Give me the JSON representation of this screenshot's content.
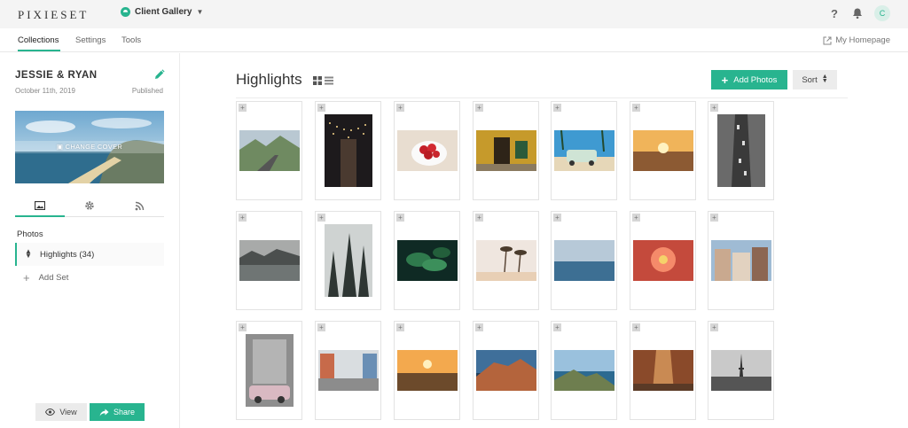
{
  "app": {
    "logo": "PIXIESET",
    "gallery_switch": "Client Gallery"
  },
  "header": {
    "help_icon": "?",
    "avatar_initial": "C"
  },
  "subnav": {
    "tabs": [
      "Collections",
      "Settings",
      "Tools"
    ],
    "active_tab": "Collections",
    "homepage_link": "My Homepage"
  },
  "sidebar": {
    "collection_title": "JESSIE & RYAN",
    "date": "October 11th, 2019",
    "status": "Published",
    "cover_label": "CHANGE COVER",
    "tabs": [
      "image-icon",
      "gear-icon",
      "rss-icon"
    ],
    "photos_heading": "Photos",
    "sets": [
      {
        "label": "Highlights (34)"
      }
    ],
    "add_set_label": "Add Set",
    "view_label": "View",
    "share_label": "Share"
  },
  "main": {
    "title": "Highlights",
    "add_photos_label": "Add Photos",
    "sort_label": "Sort",
    "handle_glyph": "+"
  },
  "photos": [
    {
      "subject": "mountain road",
      "orientation": "landscape"
    },
    {
      "subject": "string lights alley",
      "orientation": "portrait"
    },
    {
      "subject": "strawberries in cup",
      "orientation": "landscape"
    },
    {
      "subject": "yellow doorway",
      "orientation": "landscape"
    },
    {
      "subject": "van under palm trees",
      "orientation": "landscape"
    },
    {
      "subject": "sunset over city",
      "orientation": "landscape"
    },
    {
      "subject": "aerial street",
      "orientation": "portrait"
    },
    {
      "subject": "misty lake",
      "orientation": "landscape"
    },
    {
      "subject": "pine forest fog",
      "orientation": "portrait"
    },
    {
      "subject": "green leaves",
      "orientation": "landscape"
    },
    {
      "subject": "palm trees",
      "orientation": "landscape"
    },
    {
      "subject": "calm sea",
      "orientation": "landscape"
    },
    {
      "subject": "pink flower",
      "orientation": "landscape"
    },
    {
      "subject": "old buildings",
      "orientation": "landscape"
    },
    {
      "subject": "vintage car",
      "orientation": "portrait"
    },
    {
      "subject": "colorful street",
      "orientation": "landscape"
    },
    {
      "subject": "sunrise over town",
      "orientation": "landscape"
    },
    {
      "subject": "cliff village",
      "orientation": "landscape"
    },
    {
      "subject": "coastal cliffs",
      "orientation": "landscape"
    },
    {
      "subject": "narrow alley",
      "orientation": "landscape"
    },
    {
      "subject": "eiffel tower",
      "orientation": "landscape"
    }
  ],
  "colors": {
    "accent": "#28b48f",
    "topbar": "#f4f4f4",
    "border": "#e3e3e3"
  }
}
